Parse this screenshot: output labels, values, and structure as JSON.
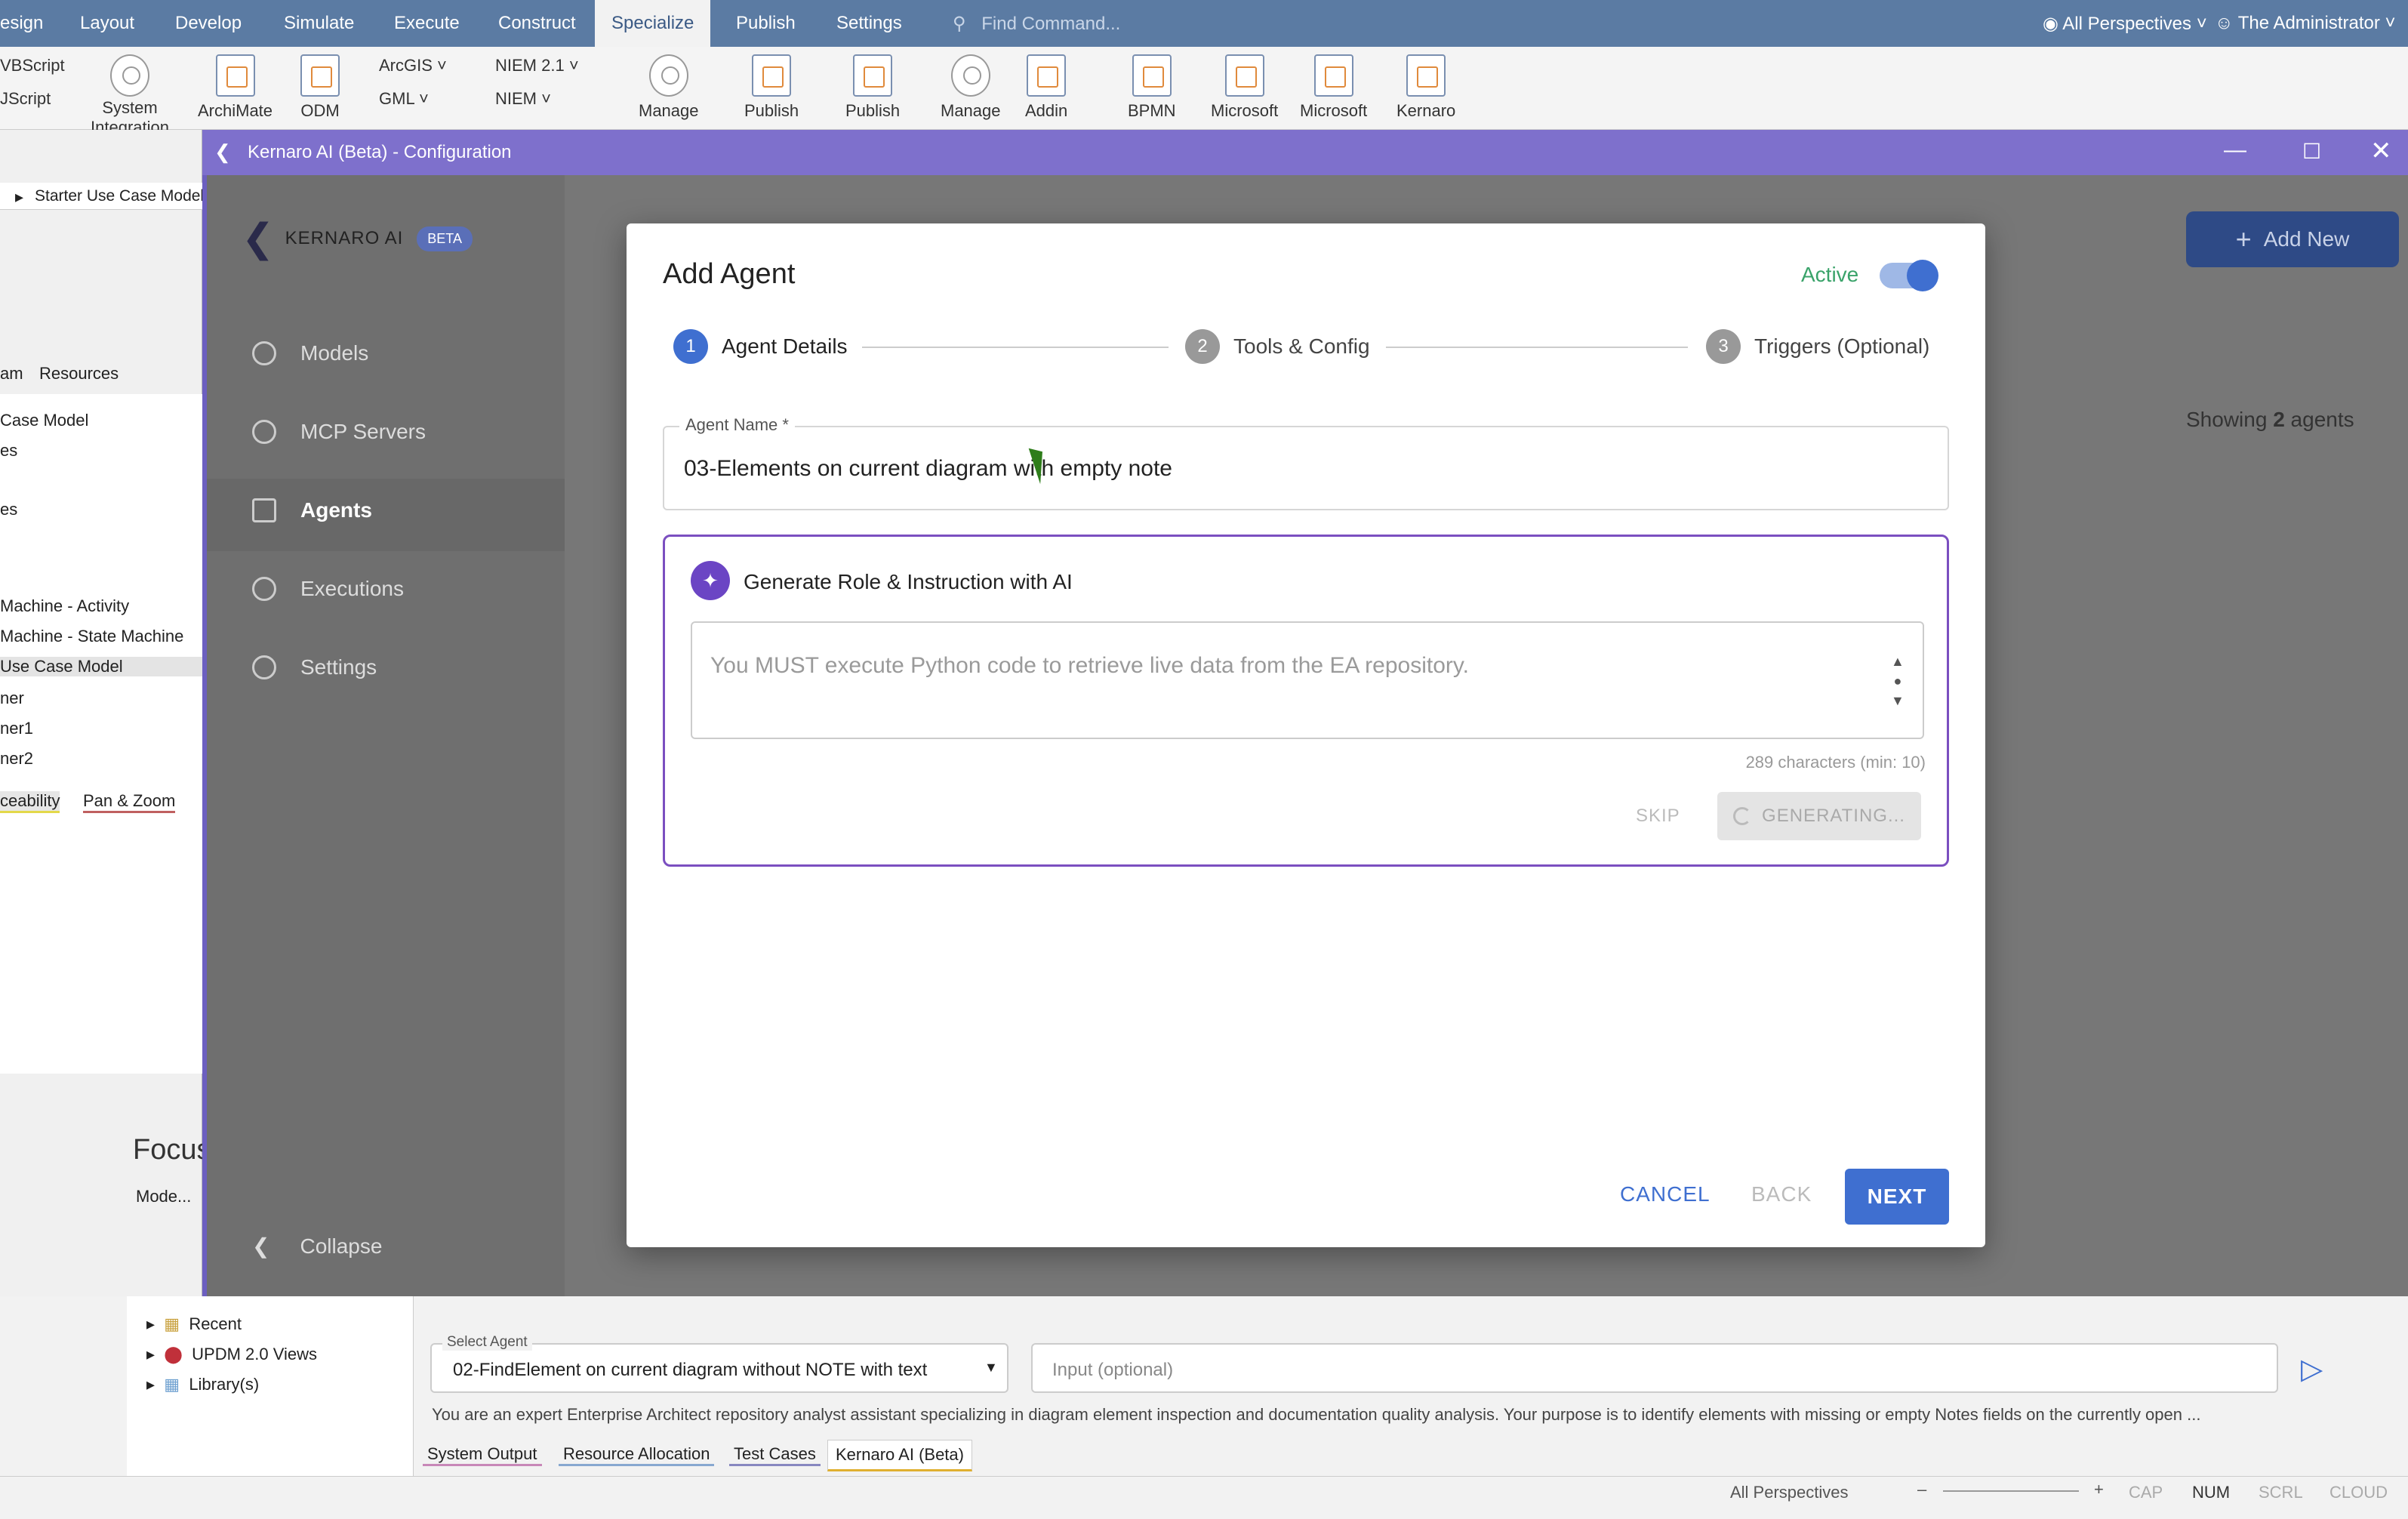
{
  "menubar": {
    "items": [
      "esign",
      "Layout",
      "Develop",
      "Simulate",
      "Execute",
      "Construct",
      "Specialize",
      "Publish",
      "Settings"
    ],
    "find_command": "Find Command...",
    "perspectives": "All Perspectives",
    "user": "The Administrator"
  },
  "ribbon": {
    "left_items": [
      "VBScript",
      "JScript"
    ],
    "buttons": [
      "System Integration",
      "ArchiMate",
      "ODM",
      "Manage",
      "Publish",
      "Publish",
      "Manage",
      "Addin",
      "BPMN",
      "Microsoft",
      "Microsoft",
      "Kernaro"
    ],
    "small": [
      "ArcGIS",
      "GML",
      "NIEM 2.1",
      "NIEM"
    ]
  },
  "left_panel": {
    "breadcrumb": "Starter Use Case Model",
    "tabs": [
      "am",
      "Resources"
    ],
    "tree": [
      "Case Model",
      "es",
      "es",
      "Machine - Activity",
      "Machine - State Machine",
      "Use Case Model",
      "ner",
      "ner1",
      "ner2"
    ],
    "bottom_tabs": [
      "ceability",
      "Pan & Zoom"
    ],
    "focus_title": "Focus",
    "mode_label": "Mode..."
  },
  "config_window": {
    "title": "Kernaro AI (Beta) - Configuration",
    "brand": "KERNARO AI",
    "badge": "BETA",
    "nav": [
      "Models",
      "MCP Servers",
      "Agents",
      "Executions",
      "Settings"
    ],
    "collapse": "Collapse",
    "add_new": "Add New",
    "showing_prefix": "Showing",
    "showing_count": "2",
    "showing_suffix": "agents"
  },
  "dialog": {
    "title": "Add Agent",
    "active_label": "Active",
    "active_on": true,
    "steps": [
      {
        "n": "1",
        "label": "Agent Details"
      },
      {
        "n": "2",
        "label": "Tools & Config"
      },
      {
        "n": "3",
        "label": "Triggers (Optional)"
      }
    ],
    "agent_name_label": "Agent Name *",
    "agent_name_value": "03-Elements on current diagram with empty note",
    "ai_section_title": "Generate Role & Instruction with AI",
    "ai_textarea_value": "You MUST execute Python code to retrieve live data from the EA repository.",
    "char_count": "289 characters (min: 10)",
    "skip": "SKIP",
    "generating": "GENERATING...",
    "cancel": "CANCEL",
    "back": "BACK",
    "next": "NEXT"
  },
  "bottom": {
    "tree": [
      "Recent",
      "UPDM 2.0 Views",
      "Library(s)"
    ],
    "select_agent_label": "Select Agent",
    "select_agent_value": "02-FindElement on current diagram without NOTE with text",
    "input_placeholder": "Input (optional)",
    "description": "You are an expert Enterprise Architect repository analyst assistant specializing in diagram element inspection and documentation quality analysis. Your purpose is to identify elements with missing or empty Notes fields on the currently open ...",
    "tabs": [
      "System Output",
      "Resource Allocation",
      "Test Cases",
      "Kernaro AI (Beta)"
    ]
  },
  "statusbar": {
    "perspectives": "All Perspectives",
    "flags": [
      "CAP",
      "NUM",
      "SCRL",
      "CLOUD"
    ]
  }
}
